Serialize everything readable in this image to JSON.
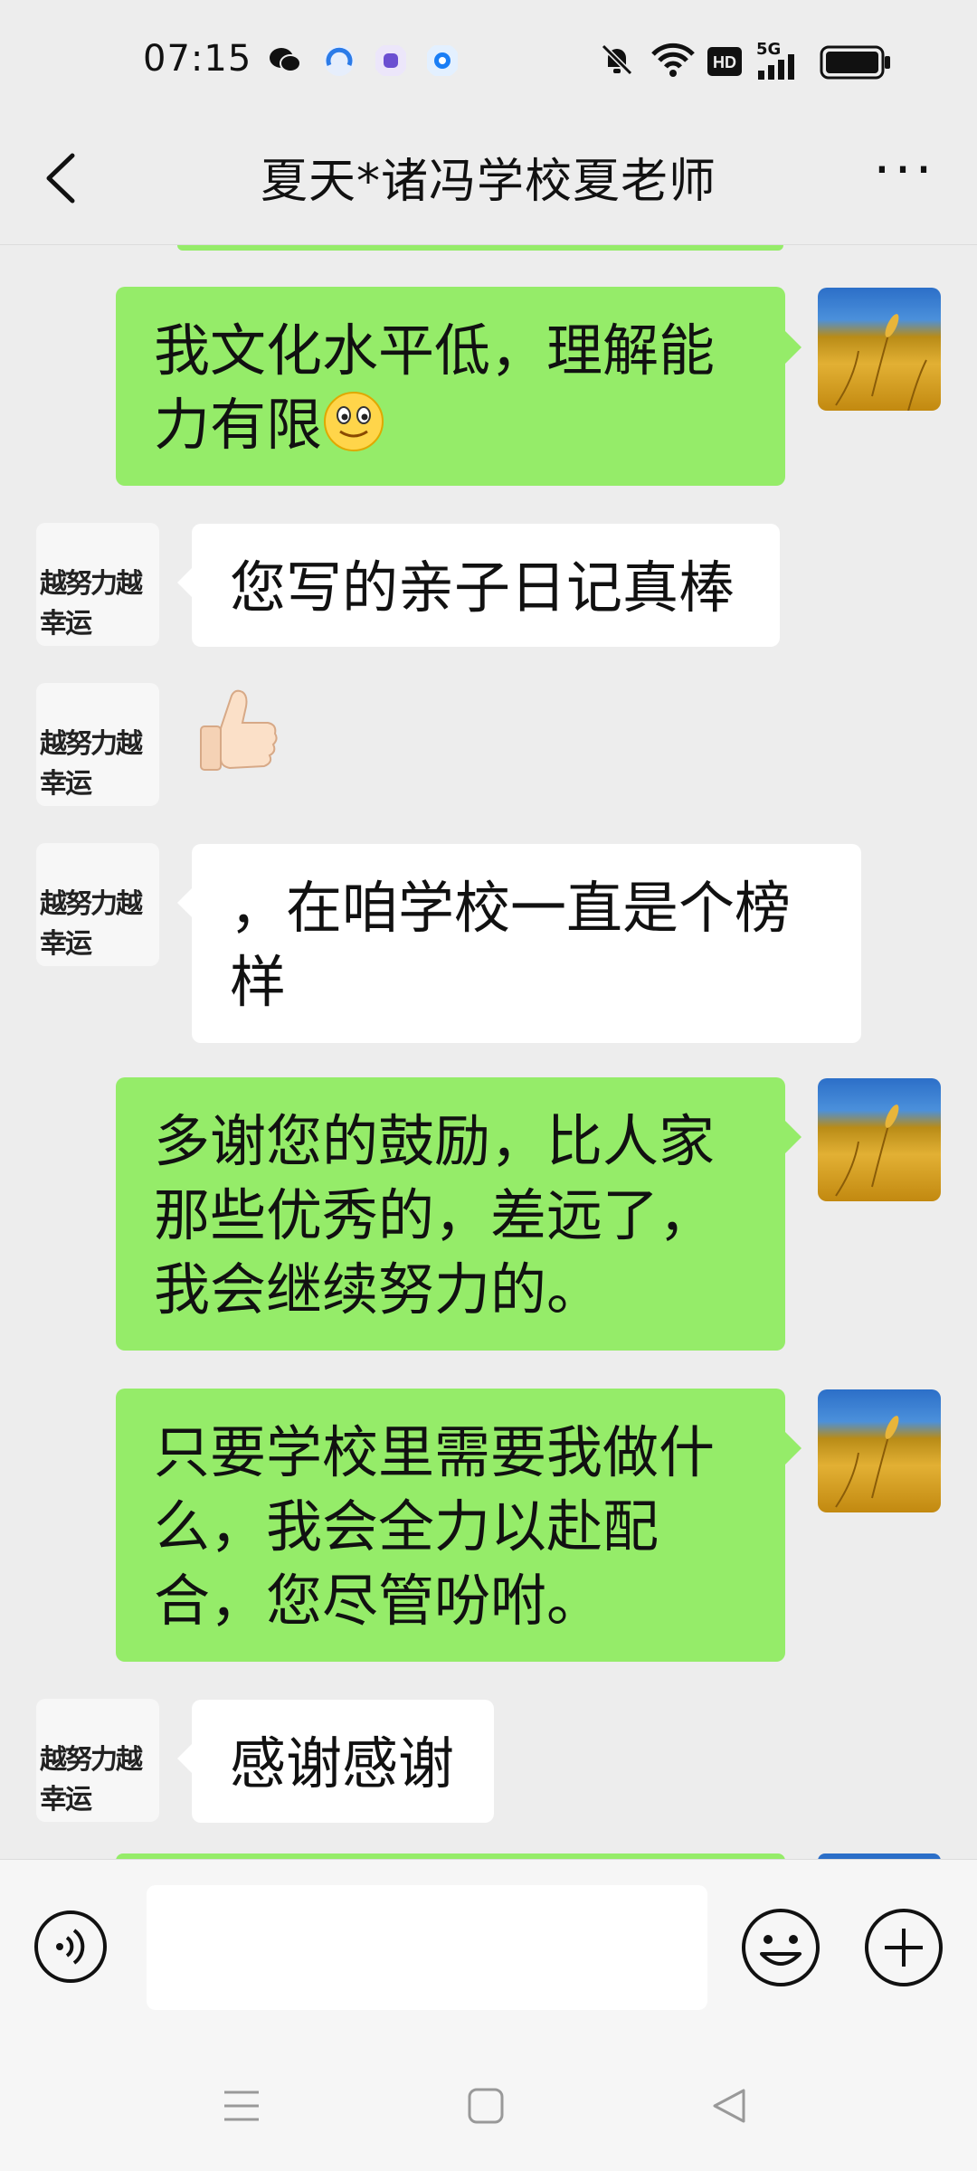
{
  "status_bar": {
    "time": "07:15",
    "network": "5G",
    "hd": "HD",
    "notification_icons": [
      "wechat-icon",
      "browser-icon",
      "app-icon",
      "app-icon"
    ],
    "icons": [
      "mute-icon",
      "wifi-icon",
      "hd-icon",
      "signal-icon",
      "battery-icon"
    ]
  },
  "header": {
    "title": "夏天*诸冯学校夏老师",
    "back_icon": "chevron-left-icon",
    "more_icon": "more-icon",
    "more_label": "···"
  },
  "avatars": {
    "self": "wheat-field-image",
    "other_logo_text": "越努力越幸运"
  },
  "messages": [
    {
      "from": "me",
      "text": "我文化水平低，理解能力有限",
      "emoji": "smile-emoji-icon"
    },
    {
      "from": "other",
      "text": "您写的亲子日记真棒"
    },
    {
      "from": "other",
      "sticker": "thumbs-up-icon"
    },
    {
      "from": "other",
      "text": "，在咱学校一直是个榜样"
    },
    {
      "from": "me",
      "text": "多谢您的鼓励，比人家那些优秀的，差远了，我会继续努力的。"
    },
    {
      "from": "me",
      "text": "只要学校里需要我做什么，我会全力以赴配合，您尽管吩咐。"
    },
    {
      "from": "other",
      "text": "感谢感谢"
    }
  ],
  "input_bar": {
    "text_value": "",
    "icons": [
      "voice-icon",
      "emoji-icon",
      "plus-icon"
    ]
  },
  "nav_bar": {
    "icons": [
      "menu-icon",
      "home-icon",
      "back-triangle-icon"
    ]
  },
  "colors": {
    "background": "#ededed",
    "my_bubble": "#95ec69",
    "their_bubble": "#ffffff"
  }
}
